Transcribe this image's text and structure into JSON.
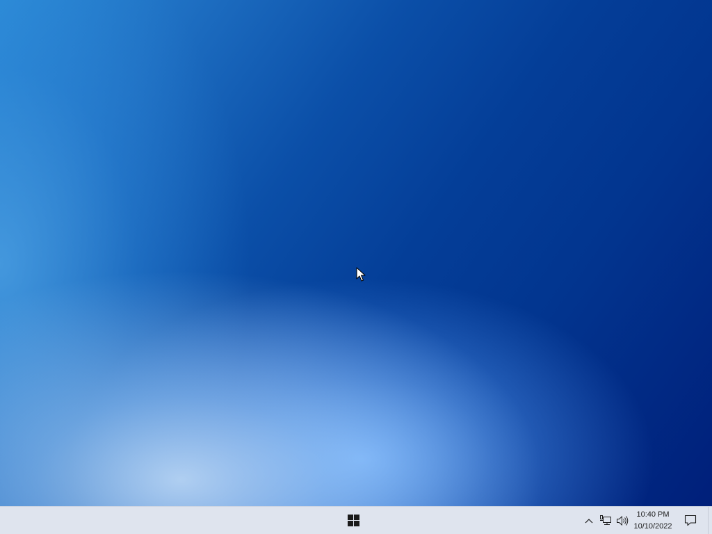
{
  "desktop": {
    "wallpaper": "blue-light-gradient",
    "colors": {
      "top_left": "#2b8ad6",
      "center": "#043e98",
      "top_right": "#001f7a",
      "bottom_glow": "#a8d0f7"
    }
  },
  "cursor": {
    "icon": "arrow-cursor-icon"
  },
  "taskbar": {
    "background": "#dfe4ee",
    "start_icon": "windows-logo-icon",
    "tray": {
      "chevron_icon": "chevron-up-icon",
      "network_icon": "network-icon",
      "volume_icon": "volume-icon"
    },
    "clock": {
      "time": "10:40 PM",
      "date": "10/10/2022"
    },
    "notification_icon": "notification-icon"
  }
}
